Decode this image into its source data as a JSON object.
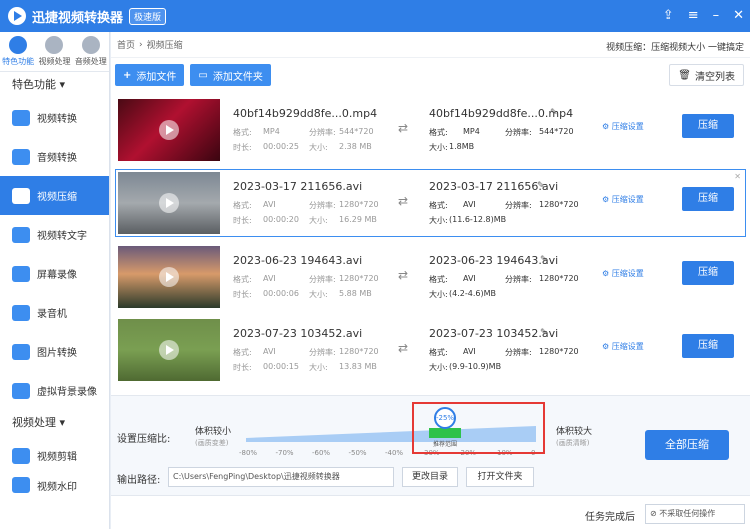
{
  "app": {
    "title": "迅捷视频转换器",
    "badge": "极速版"
  },
  "sidebar": {
    "top_tabs": [
      {
        "label": "特色功能",
        "icon": "star-icon"
      },
      {
        "label": "视频处理",
        "icon": "film-icon"
      },
      {
        "label": "音频处理",
        "icon": "music-icon"
      }
    ],
    "section1": "特色功能",
    "items": [
      {
        "label": "视频转换"
      },
      {
        "label": "音频转换"
      },
      {
        "label": "视频压缩"
      },
      {
        "label": "视频转文字"
      },
      {
        "label": "屏幕录像"
      },
      {
        "label": "录音机"
      },
      {
        "label": "图片转换"
      },
      {
        "label": "虚拟背景录像"
      }
    ],
    "section2": "视频处理",
    "items2": [
      {
        "label": "视频剪辑"
      },
      {
        "label": "视频水印"
      }
    ]
  },
  "breadcrumb": {
    "home": "首页",
    "sep": "›",
    "current": "视频压缩",
    "right": "视频压缩：压缩视频大小 一键搞定"
  },
  "toolbar": {
    "add_file": "添加文件",
    "add_folder": "添加文件夹",
    "clear": "清空列表"
  },
  "labels": {
    "format": "格式:",
    "resolution": "分辨率:",
    "duration": "时长:",
    "size": "大小:",
    "compress_settings": "压缩设置",
    "compress": "压缩"
  },
  "files": [
    {
      "name": "40bf14b929dd8fe...0.mp4",
      "format": "MP4",
      "resolution": "544*720",
      "duration": "00:00:25",
      "size": "2.38 MB",
      "out_name": "40bf14b929dd8fe...0.mp4",
      "out_format": "MP4",
      "out_resolution": "544*720",
      "out_size": "1.8MB"
    },
    {
      "name": "2023-03-17 211656.avi",
      "format": "AVI",
      "resolution": "1280*720",
      "duration": "00:00:20",
      "size": "16.29 MB",
      "out_name": "2023-03-17 211656.avi",
      "out_format": "AVI",
      "out_resolution": "1280*720",
      "out_size": "(11.6-12.8)MB"
    },
    {
      "name": "2023-06-23 194643.avi",
      "format": "AVI",
      "resolution": "1280*720",
      "duration": "00:00:06",
      "size": "5.88 MB",
      "out_name": "2023-06-23 194643.avi",
      "out_format": "AVI",
      "out_resolution": "1280*720",
      "out_size": "(4.2-4.6)MB"
    },
    {
      "name": "2023-07-23 103452.avi",
      "format": "AVI",
      "resolution": "1280*720",
      "duration": "00:00:15",
      "size": "13.83 MB",
      "out_name": "2023-07-23 103452.avi",
      "out_format": "AVI",
      "out_resolution": "1280*720",
      "out_size": "(9.9-10.9)MB"
    }
  ],
  "compression": {
    "label": "设置压缩比:",
    "small": "体积较小",
    "small_sub": "(画质变差)",
    "large": "体积较大",
    "large_sub": "(画质清晰)",
    "value": "-25%",
    "recommend": "推荐范围",
    "ticks": [
      "-80%",
      "-70%",
      "-60%",
      "-50%",
      "-40%",
      "-30%",
      "-20%",
      "-10%",
      "0"
    ]
  },
  "output": {
    "label": "输出路径:",
    "path": "C:\\Users\\FengPing\\Desktop\\迅捷视频转换器",
    "change": "更改目录",
    "open": "打开文件夹"
  },
  "compress_all": "全部压缩",
  "status": {
    "done_label": "任务完成后",
    "done_option": "不采取任何操作"
  }
}
